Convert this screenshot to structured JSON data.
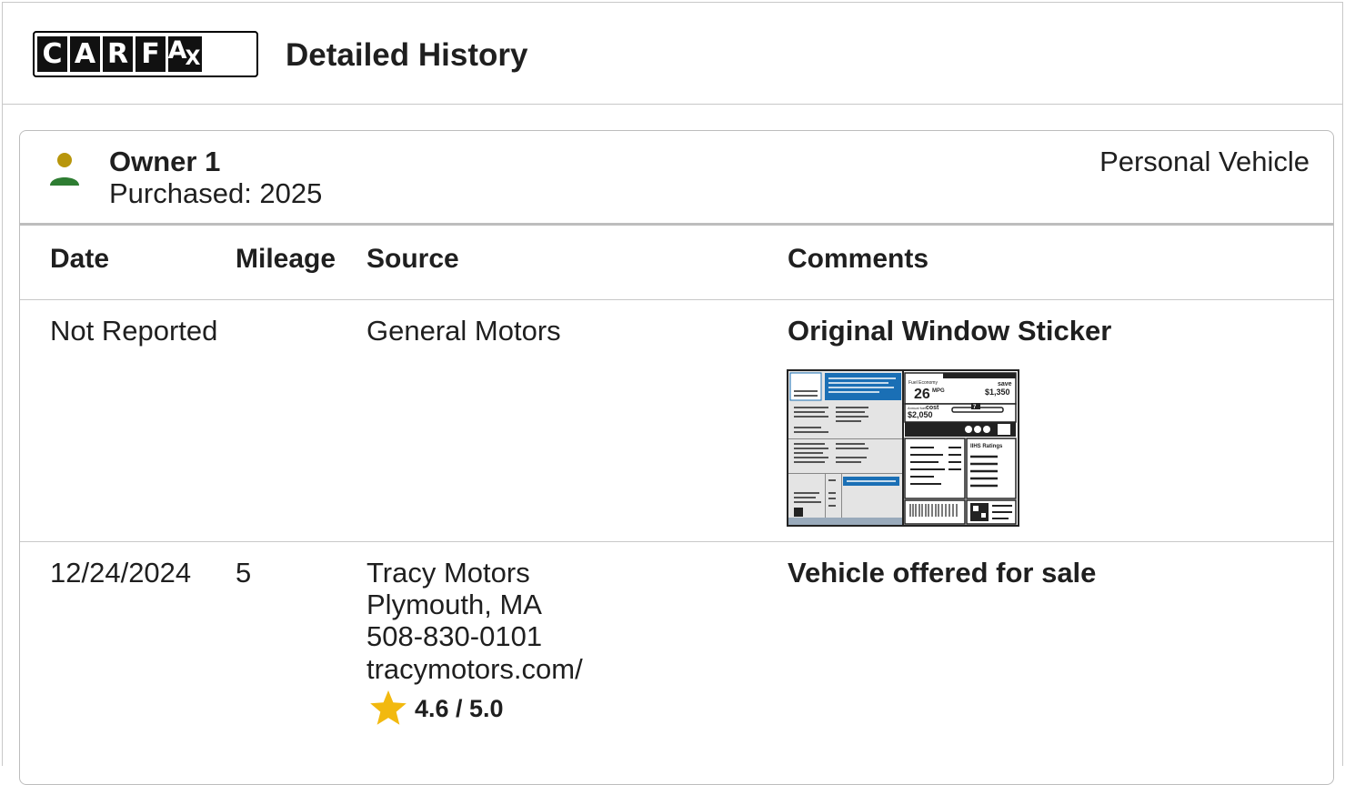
{
  "header": {
    "logo_letters": [
      "C",
      "A",
      "R",
      "F",
      "A",
      "X"
    ],
    "title": "Detailed History"
  },
  "owner": {
    "name": "Owner 1",
    "purchased": "Purchased: 2025",
    "type": "Personal Vehicle",
    "icon": "person-icon",
    "colors": {
      "head": "#b8960c",
      "body": "#2e7d32"
    }
  },
  "table": {
    "columns": {
      "date": "Date",
      "mileage": "Mileage",
      "source": "Source",
      "comments": "Comments"
    },
    "rows": [
      {
        "date": "Not Reported",
        "mileage": "",
        "source": [
          "General Motors"
        ],
        "comment": "Original Window Sticker",
        "thumbnail": "window-sticker-thumbnail"
      },
      {
        "date": "12/24/2024",
        "mileage": "5",
        "source": [
          "Tracy Motors",
          "Plymouth, MA",
          "508-830-0101",
          "tracymotors.com/"
        ],
        "comment": "Vehicle offered for sale",
        "rating": "4.6 / 5.0"
      }
    ]
  },
  "sticker": {
    "mpg": "26",
    "mpg_unit": "MPG",
    "save_label": "save",
    "save_value": "$1,350",
    "cost_label": "cost",
    "cost_value": "$2,050",
    "ratings_label": "IIHS Ratings",
    "fuel_economy_label": "Fuel Economy",
    "annual_label": "Annual fuel",
    "scale_value": "7"
  },
  "colors": {
    "star": "#f2b90f",
    "sticker_blue": "#1a6fb5",
    "border": "#c8c8c8"
  }
}
